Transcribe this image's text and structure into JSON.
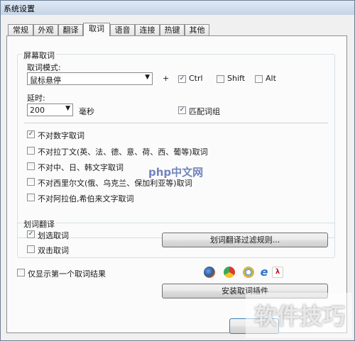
{
  "window": {
    "title": "系统设置"
  },
  "tabs": [
    "常规",
    "外观",
    "翻译",
    "取词",
    "语音",
    "连接",
    "热键",
    "其他"
  ],
  "screen_lookup": {
    "group_label": "屏幕取词",
    "mode_label": "取词模式:",
    "mode_value": "鼠标悬停",
    "plus": "+",
    "ctrl_label": "Ctrl",
    "shift_label": "Shift",
    "alt_label": "Alt",
    "delay_label": "延时:",
    "delay_value": "200",
    "delay_unit": "毫秒",
    "phrase_label": "匹配词组",
    "options": [
      "不对数字取词",
      "不对拉丁文(英、法、德、意、荷、西、葡等)取词",
      "不对中、日、韩文字取词",
      "不对西里尔文(俄、乌克兰、保加利亚等)取词",
      "不对阿拉伯,希伯来文字取词"
    ]
  },
  "select_translate": {
    "group_label": "划词翻译",
    "select_label": "划选取词",
    "dblclick_label": "双击取词",
    "filter_button": "划词翻译过滤规则..."
  },
  "bottom": {
    "first_result_label": "仅显示第一个取词结果",
    "install_button": "安装取词插件"
  },
  "watermarks": {
    "php": "php中文网",
    "soft": "软件技巧"
  },
  "colors": {
    "accent": "#2a3e6b"
  }
}
